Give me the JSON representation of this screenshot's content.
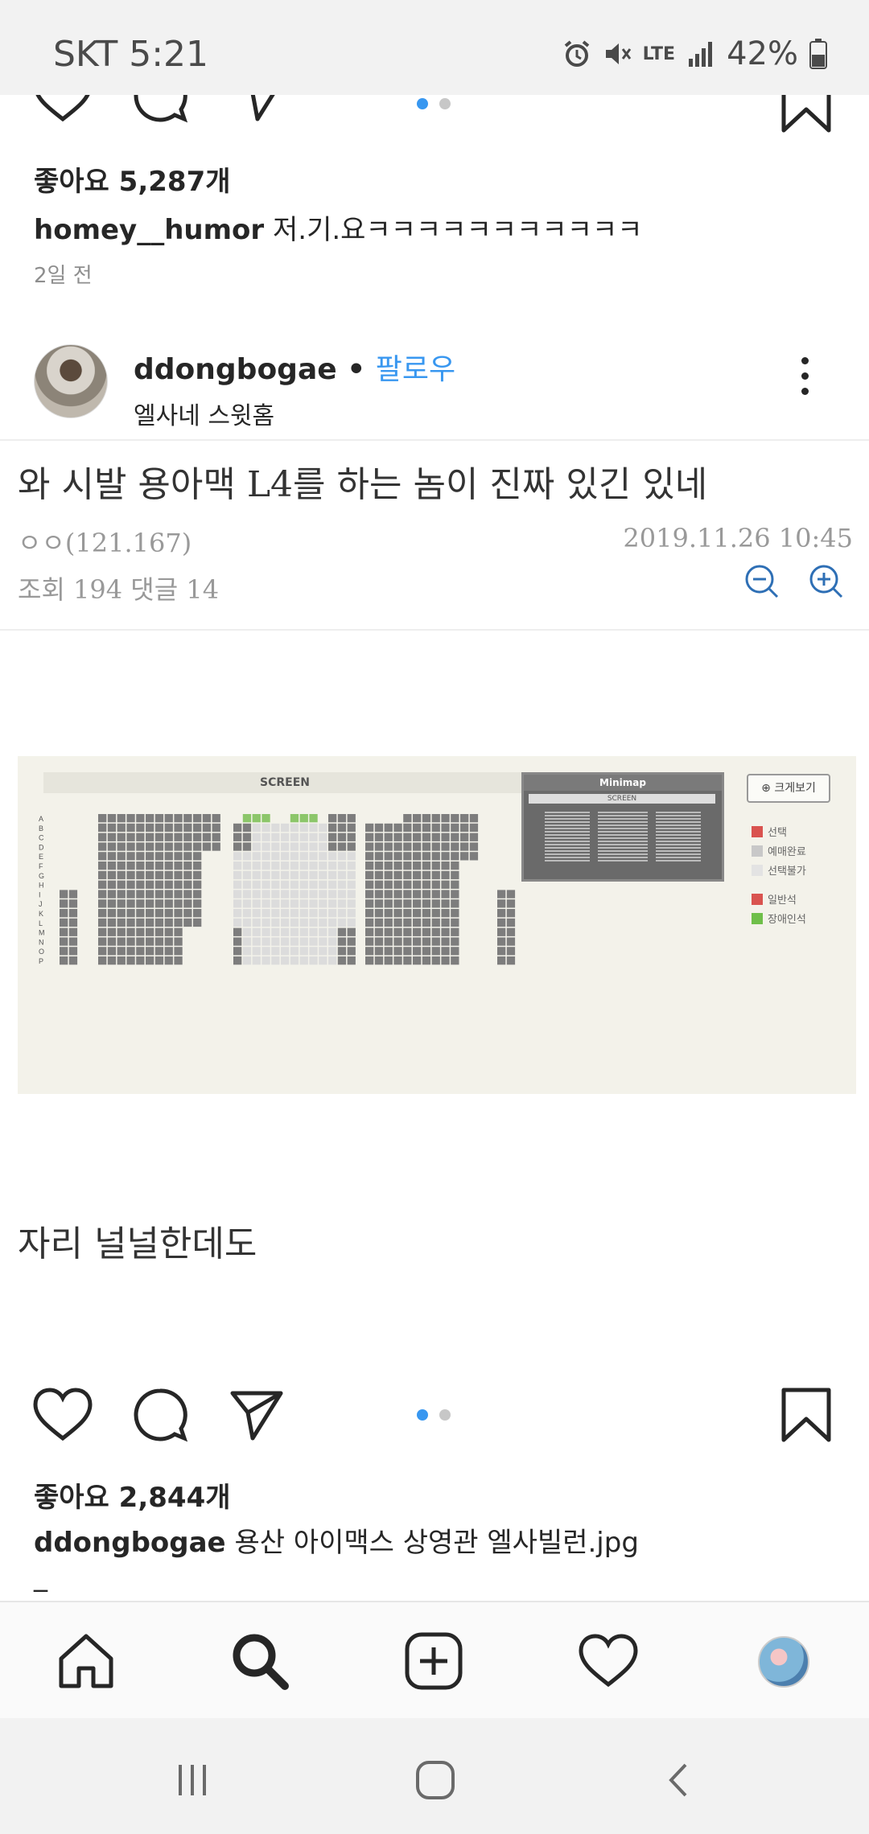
{
  "status_bar": {
    "carrier_time": "SKT 5:21",
    "network": "LTE",
    "battery": "42%",
    "icons": [
      "alarm-icon",
      "mute-icon",
      "lte-icon",
      "signal-icon",
      "battery-icon"
    ]
  },
  "post1": {
    "likes": "좋아요 5,287개",
    "username": "homey__humor",
    "caption": "저.기.요ㅋㅋㅋㅋㅋㅋㅋㅋㅋㅋㅋ",
    "time": "2일 전",
    "carousel_index": 1,
    "carousel_count": 2
  },
  "post2": {
    "username": "ddongbogae",
    "separator": " • ",
    "follow_label": "팔로우",
    "subtitle": "엘사네 스윗홈",
    "content": {
      "title": "와 시발 용아맥 L4를 하는 놈이 진짜 있긴 있네",
      "author": "ㅇㅇ(121.167)",
      "date": "2019.11.26 10:45",
      "stats": "조회 194 댓글 14",
      "seatmap": {
        "screen_label": "SCREEN",
        "minimap_title": "Minimap",
        "minimap_screen": "SCREEN",
        "zoom_label": "크게보기",
        "rows": [
          "A",
          "B",
          "C",
          "D",
          "E",
          "F",
          "G",
          "H",
          "I",
          "J",
          "K",
          "L",
          "M",
          "N",
          "O",
          "P"
        ],
        "legend": [
          {
            "label": "선택",
            "color": "#d9534f"
          },
          {
            "label": "예매완료",
            "color": "#c8c8c8"
          },
          {
            "label": "선택불가",
            "color": "#e3e3e3"
          },
          {
            "label": "일반석",
            "color": "#d9534f"
          },
          {
            "label": "장애인석",
            "color": "#6fbf4a"
          }
        ],
        "colors": {
          "taken": "#7d7d7d",
          "available": "#dcdcdc",
          "wheelchair": "#8cc66a"
        }
      },
      "body": "자리 널널한데도"
    },
    "likes": "좋아요 2,844개",
    "caption_username": "ddongbogae",
    "caption": "용산 아이맥스 상영관 엘사빌런.jpg",
    "carousel_index": 1,
    "carousel_count": 2,
    "more_mark": "_"
  },
  "bottom_nav": [
    "home-icon",
    "search-icon",
    "add-post-icon",
    "activity-heart-icon",
    "profile-avatar-icon"
  ],
  "android_nav": [
    "recents-icon",
    "home-button-icon",
    "back-icon"
  ],
  "accent_color": "#3897f0"
}
